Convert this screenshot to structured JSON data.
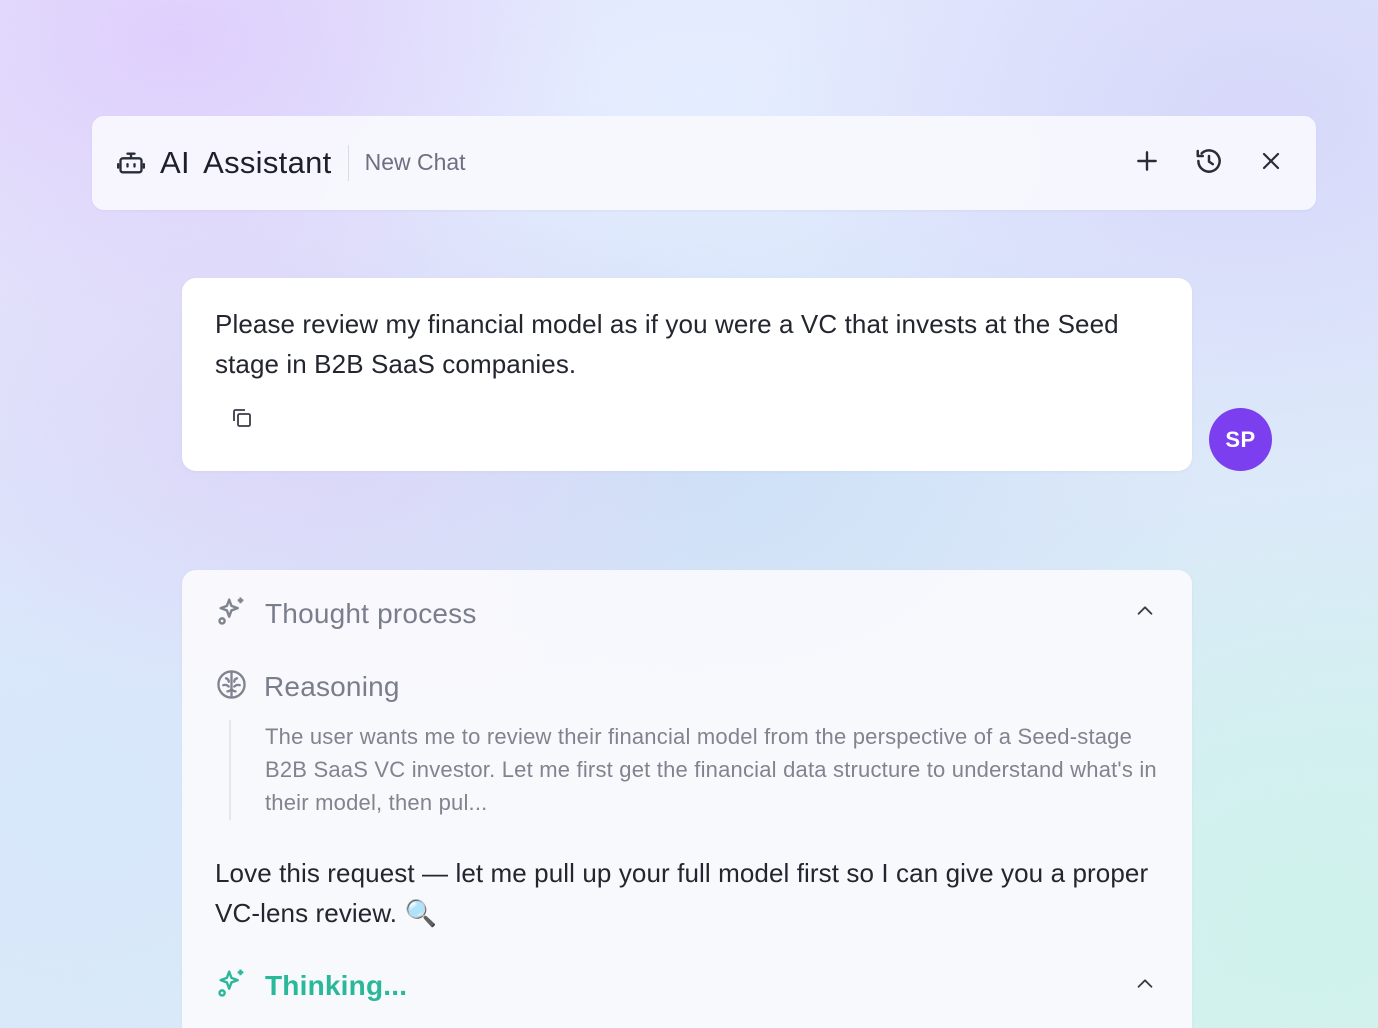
{
  "header": {
    "title": "AI Assistant",
    "chat_name": "New Chat",
    "icons": [
      "robot-icon",
      "plus-icon",
      "history-icon",
      "close-icon"
    ]
  },
  "user_message": {
    "text": "Please review my financial model as if you were a VC that invests at the Seed stage in B2B SaaS companies.",
    "avatar_initials": "SP",
    "avatar_color": "#7b3ff0"
  },
  "assistant": {
    "thought_process_label": "Thought process",
    "reasoning_label": "Reasoning",
    "reasoning_text": "The user wants me to review their financial model from the perspective of a Seed-stage B2B SaaS VC investor. Let me first get the financial data structure to understand what's in their model, then pul...",
    "reply_text": "Love this request — let me pull up your full model first so I can give you a proper VC-lens review. 🔍",
    "thinking_label": "Thinking...",
    "thinking_color": "#29b89a"
  }
}
